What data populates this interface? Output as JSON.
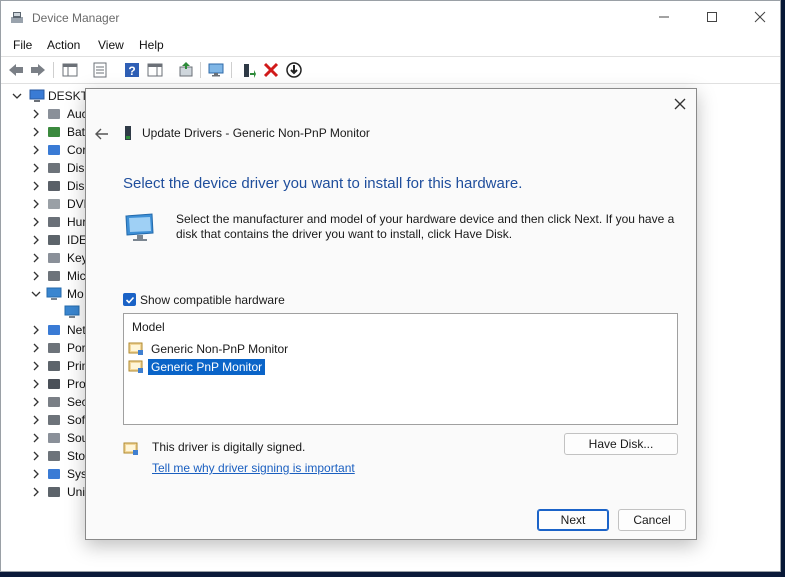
{
  "window": {
    "title": "Device Manager",
    "menu": [
      "File",
      "Action",
      "View",
      "Help"
    ]
  },
  "tree": {
    "root": "DESKTO",
    "items": [
      {
        "label": "Auc",
        "icon": "speaker-icon",
        "expanded": false
      },
      {
        "label": "Batt",
        "icon": "battery-icon",
        "expanded": false
      },
      {
        "label": "Cor",
        "icon": "computer-icon",
        "expanded": false
      },
      {
        "label": "Disk",
        "icon": "disk-drive-icon",
        "expanded": false
      },
      {
        "label": "Disp",
        "icon": "display-adapter-icon",
        "expanded": false
      },
      {
        "label": "DVD",
        "icon": "dvd-drive-icon",
        "expanded": false
      },
      {
        "label": "Hur",
        "icon": "hid-icon",
        "expanded": false
      },
      {
        "label": "IDE",
        "icon": "ide-controller-icon",
        "expanded": false
      },
      {
        "label": "Key",
        "icon": "keyboard-icon",
        "expanded": false
      },
      {
        "label": "Mic",
        "icon": "mouse-icon",
        "expanded": false
      },
      {
        "label": "Mo",
        "icon": "monitor-icon",
        "expanded": true
      },
      {
        "label": "",
        "icon": "monitor-icon",
        "expanded": false
      },
      {
        "label": "Net",
        "icon": "network-adapter-icon",
        "expanded": false
      },
      {
        "label": "Por",
        "icon": "ports-icon",
        "expanded": false
      },
      {
        "label": "Prin",
        "icon": "printer-icon",
        "expanded": false
      },
      {
        "label": "Pro",
        "icon": "processor-icon",
        "expanded": false
      },
      {
        "label": "Sec",
        "icon": "security-device-icon",
        "expanded": false
      },
      {
        "label": "Soft",
        "icon": "software-device-icon",
        "expanded": false
      },
      {
        "label": "Sou",
        "icon": "sound-icon",
        "expanded": false
      },
      {
        "label": "Stor",
        "icon": "storage-controller-icon",
        "expanded": false
      },
      {
        "label": "Syst",
        "icon": "system-device-icon",
        "expanded": false
      },
      {
        "label": "Uni",
        "icon": "usb-icon",
        "expanded": false
      }
    ]
  },
  "dialog": {
    "heading": "Update Drivers - Generic Non-PnP Monitor",
    "instruction": "Select the device driver you want to install for this hardware.",
    "description": "Select the manufacturer and model of your hardware device and then click Next. If you have a disk that contains the driver you want to install, click Have Disk.",
    "show_compatible_label": "Show compatible hardware",
    "show_compatible_checked": true,
    "model_header": "Model",
    "models": [
      {
        "label": "Generic Non-PnP Monitor",
        "selected": false
      },
      {
        "label": "Generic PnP Monitor",
        "selected": true
      }
    ],
    "signed_text": "This driver is digitally signed.",
    "signing_link": "Tell me why driver signing is important",
    "have_disk_label": "Have Disk...",
    "next_label": "Next",
    "cancel_label": "Cancel"
  },
  "colors": {
    "accent": "#1a62c6",
    "instruction_text": "#1f4e9c",
    "link": "#1a5fc0",
    "selection": "#0a64c8"
  }
}
